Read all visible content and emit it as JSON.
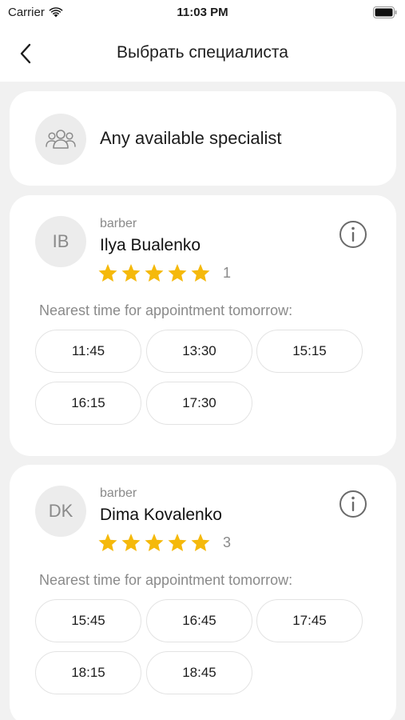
{
  "status_bar": {
    "carrier": "Carrier",
    "time": "11:03 PM"
  },
  "header": {
    "title": "Выбрать специалиста",
    "back_icon": "chevron-left-icon"
  },
  "any_specialist": {
    "label": "Any available specialist",
    "icon": "people-icon"
  },
  "specialists": [
    {
      "initials": "IB",
      "role": "barber",
      "name": "Ilya Bualenko",
      "stars": 5,
      "rating_count": "1",
      "nearest_label": "Nearest time for appointment tomorrow:",
      "slots": [
        "11:45",
        "13:30",
        "15:15",
        "16:15",
        "17:30"
      ]
    },
    {
      "initials": "DK",
      "role": "barber",
      "name": "Dima Kovalenko",
      "stars": 5,
      "rating_count": "3",
      "nearest_label": "Nearest time for appointment tomorrow:",
      "slots": [
        "15:45",
        "16:45",
        "17:45",
        "18:15",
        "18:45"
      ]
    }
  ],
  "colors": {
    "star": "#f5b90b",
    "background": "#f1f1f1",
    "card": "#ffffff",
    "muted_text": "#8a8a8a"
  }
}
